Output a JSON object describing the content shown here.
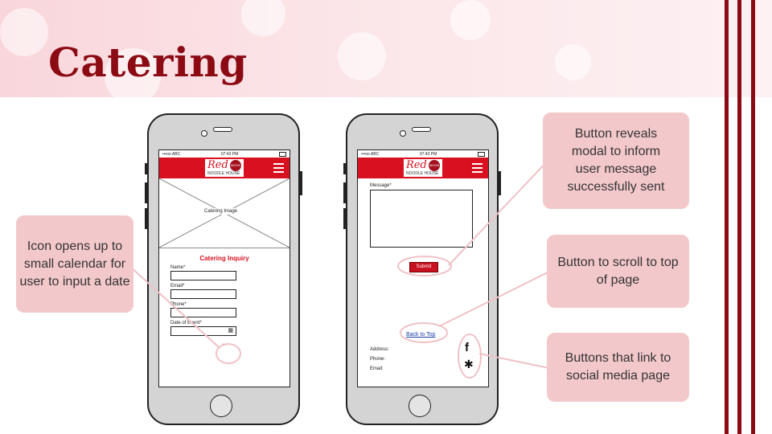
{
  "slide": {
    "title": "Catering",
    "accent_color": "#8b0a14"
  },
  "phone_common": {
    "carrier": "•••oo ABC",
    "time": "07:43 PM",
    "logo_text": "Red",
    "logo_moon": "MOON",
    "logo_subtitle": "NOODLE HOUSE",
    "menu_icon": "hamburger-menu-icon",
    "appbar_color": "#d8101f"
  },
  "phone1": {
    "image_caption": "Catering Image",
    "form_title": "Catering Inquiry",
    "fields": [
      {
        "label": "Name*",
        "value": ""
      },
      {
        "label": "Email*",
        "value": ""
      },
      {
        "label": "Phone*",
        "value": ""
      },
      {
        "label": "Date of Event*",
        "value": ""
      }
    ],
    "calendar_icon": "calendar-icon",
    "scroll_icon": "chevron-down-icon"
  },
  "phone2": {
    "message_label": "Message*",
    "message_value": "",
    "submit_label": "Submit",
    "back_to_top": "Back to Top",
    "address_label": "Address:",
    "phone_label": "Phone:",
    "email_label": "Email:",
    "social_icons": [
      "facebook-icon",
      "yelp-icon"
    ]
  },
  "callouts": {
    "calendar": "Icon opens up to small calendar for user to input a date",
    "submit": "Button reveals modal to inform user message successfully sent",
    "back_to_top": "Button to scroll to top of page",
    "social": "Buttons that link to social media page"
  }
}
